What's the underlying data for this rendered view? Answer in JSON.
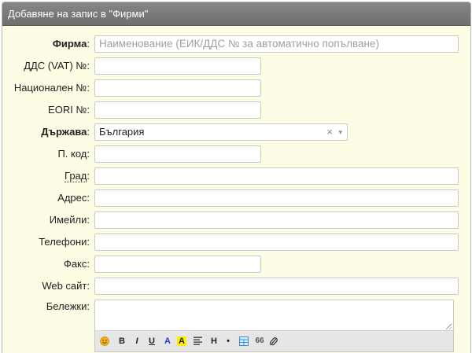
{
  "dialog": {
    "title": "Добавяне на запис в \"Фирми\""
  },
  "fields": {
    "firm": {
      "label": "Фирма",
      "placeholder": "Наименование (ЕИК/ДДС № за автоматично попълване)",
      "value": ""
    },
    "vat": {
      "label": "ДДС (VAT) №:",
      "value": ""
    },
    "national": {
      "label": "Национален №:",
      "value": ""
    },
    "eori": {
      "label": "EORI №:",
      "value": ""
    },
    "country": {
      "label": "Държава",
      "value": "България",
      "clear": "×",
      "arrow": "▾"
    },
    "postcode": {
      "label": "П. код:",
      "value": ""
    },
    "city": {
      "label": "Град",
      "value": ""
    },
    "address": {
      "label": "Адрес:",
      "value": ""
    },
    "emails": {
      "label": "Имейли:",
      "value": ""
    },
    "phones": {
      "label": "Телефони:",
      "value": ""
    },
    "fax": {
      "label": "Факс:",
      "value": ""
    },
    "website": {
      "label": "Web сайт:",
      "value": ""
    },
    "notes": {
      "label": "Бележки:",
      "value": ""
    }
  },
  "punct": {
    "colon": ":"
  },
  "toolbar": {
    "bold": "B",
    "italic": "I",
    "underline": "U",
    "font_color": "A",
    "highlight": "A",
    "heading": "H",
    "bullet": "•",
    "quote": "66",
    "icons": [
      "emoji-icon",
      "bold-icon",
      "italic-icon",
      "underline-icon",
      "font-color-icon",
      "highlight-icon",
      "align-icon",
      "heading-icon",
      "bullet-icon",
      "table-icon",
      "quote-icon",
      "attachment-icon"
    ]
  },
  "colors": {
    "titlebar": "#7a7a7a",
    "panel": "#fdfce4",
    "font_color": "#1a3fd6",
    "highlight": "#ffee00",
    "table_icon": "#3a8ed8"
  }
}
